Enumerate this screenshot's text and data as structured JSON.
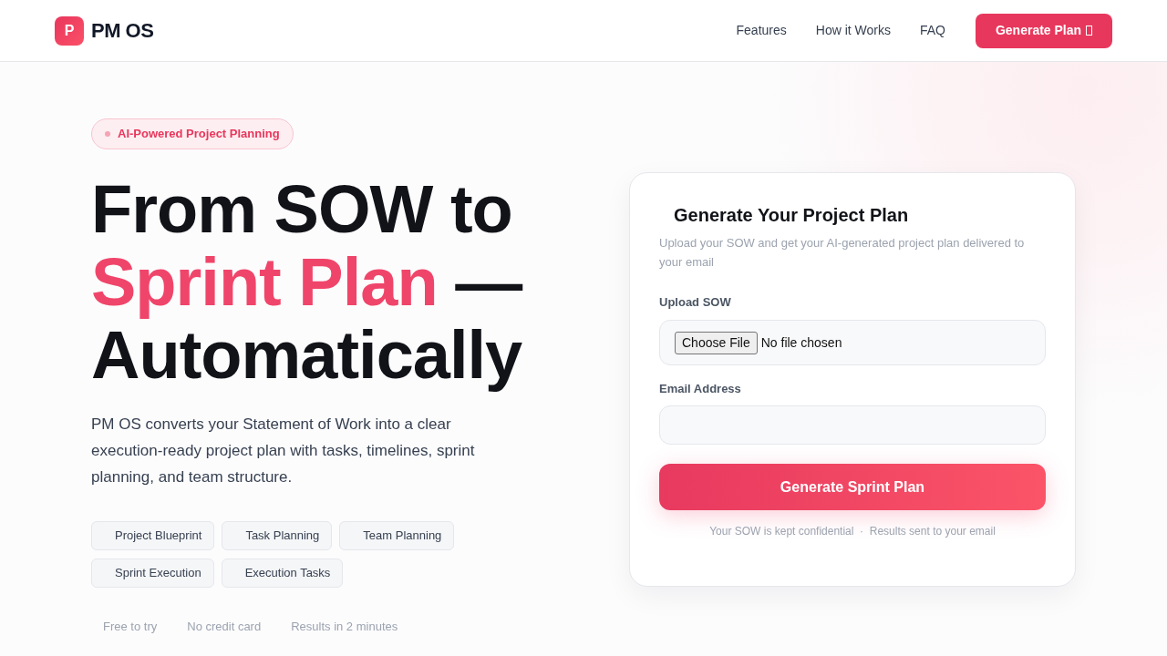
{
  "header": {
    "logo": {
      "letter": "P",
      "name": "PM OS"
    },
    "nav": [
      "Features",
      "How it Works",
      "FAQ"
    ],
    "cta": {
      "label": "Generate Plan"
    }
  },
  "hero": {
    "badge": "AI-Powered Project Planning",
    "heading": [
      {
        "text": "From SOW to",
        "highlight": false
      },
      {
        "text": "Sprint Plan",
        "highlight": true
      },
      {
        "text": "— Automatically",
        "highlight": false
      }
    ],
    "description": "PM OS converts your Statement of Work into a clear execution-ready project plan with tasks, timelines, sprint planning, and team structure.",
    "chips": [
      "Project Blueprint",
      "Task Planning",
      "Team Planning",
      "Sprint Execution",
      "Execution Tasks"
    ],
    "perks": [
      "Free to try",
      "No credit card",
      "Results in 2 minutes"
    ]
  },
  "form": {
    "title": "Generate Your Project Plan",
    "subtitle": "Upload your SOW and get your AI-generated project plan delivered to your email",
    "fields": [
      {
        "kind": "file",
        "label": "Upload SOW",
        "button": "Choose File",
        "value": "No file chosen"
      },
      {
        "kind": "email",
        "label": "Email Address"
      }
    ],
    "submit": "Generate Sprint Plan",
    "note": "Your SOW is kept confidential  ·  Results sent to your email"
  }
}
